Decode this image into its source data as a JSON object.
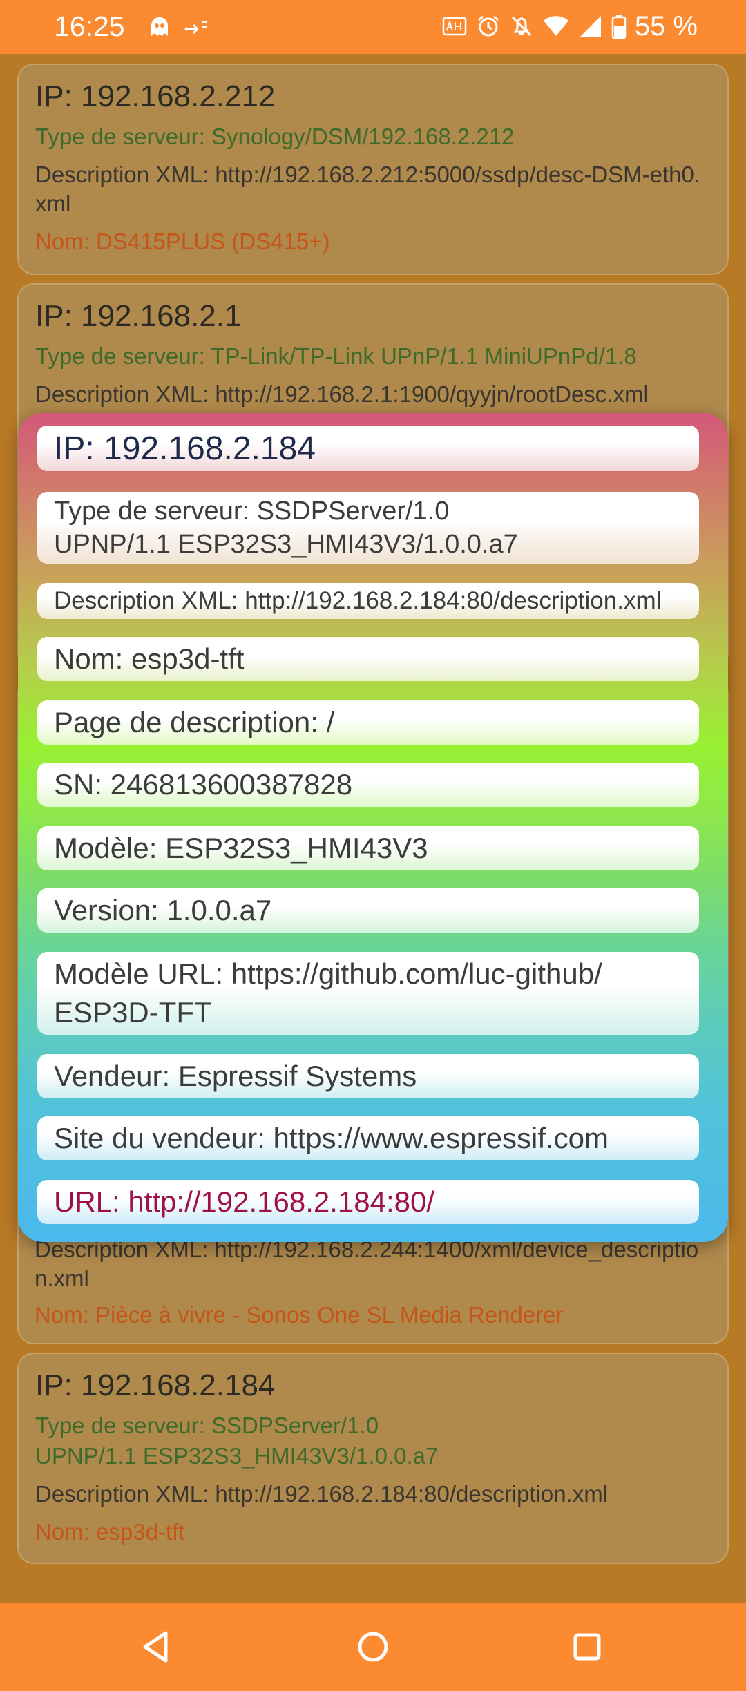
{
  "status_bar": {
    "time": "16:25",
    "battery_percent": "55 %",
    "icons": [
      "ghost-app-icon",
      "cast-icon",
      "auto-hd-icon",
      "alarm-icon",
      "mute-icon",
      "wifi-icon",
      "signal-icon",
      "battery-icon"
    ]
  },
  "devices": [
    {
      "ip": "IP: 192.168.2.212",
      "type": "Type de serveur: Synology/DSM/192.168.2.212",
      "desc": "Description XML: http://192.168.2.212:5000/ssdp/desc-DSM-eth0.xml",
      "name": "Nom: DS415PLUS (DS415+)"
    },
    {
      "ip": "IP: 192.168.2.1",
      "type": "Type de serveur: TP-Link/TP-Link UPnP/1.1 MiniUPnPd/1.8",
      "desc": "Description XML: http://192.168.2.1:1900/qyyjn/rootDesc.xml"
    },
    {
      "desc": "Description XML: http://192.168.2.244:1400/xml/device_description.xml",
      "name": "Nom: Pièce à vivre - Sonos One SL Media Renderer"
    },
    {
      "ip": "IP: 192.168.2.184",
      "type": "Type de serveur: SSDPServer/1.0 UPNP/1.1 ESP32S3_HMI43V3/1.0.0.a7",
      "desc": "Description XML: http://192.168.2.184:80/description.xml",
      "name": "Nom: esp3d-tft"
    }
  ],
  "popup": {
    "ip": "IP: 192.168.2.184",
    "type": "Type de serveur: SSDPServer/1.0 UPNP/1.1 ESP32S3_HMI43V3/1.0.0.a7",
    "desc": "Description XML: http://192.168.2.184:80/description.xml",
    "name": "Nom: esp3d-tft",
    "page": "Page de description: /",
    "sn": "SN: 246813600387828",
    "model": "Modèle: ESP32S3_HMI43V3",
    "version": "Version: 1.0.0.a7",
    "model_url": "Modèle URL: https://github.com/luc-github/ESP3D-TFT",
    "vendor": "Vendeur: Espressif Systems",
    "vendor_site": "Site du vendeur: https://www.espressif.com",
    "url": "URL: http://192.168.2.184:80/"
  },
  "nav": {
    "back": "back-icon",
    "home": "home-icon",
    "recents": "recents-icon"
  }
}
